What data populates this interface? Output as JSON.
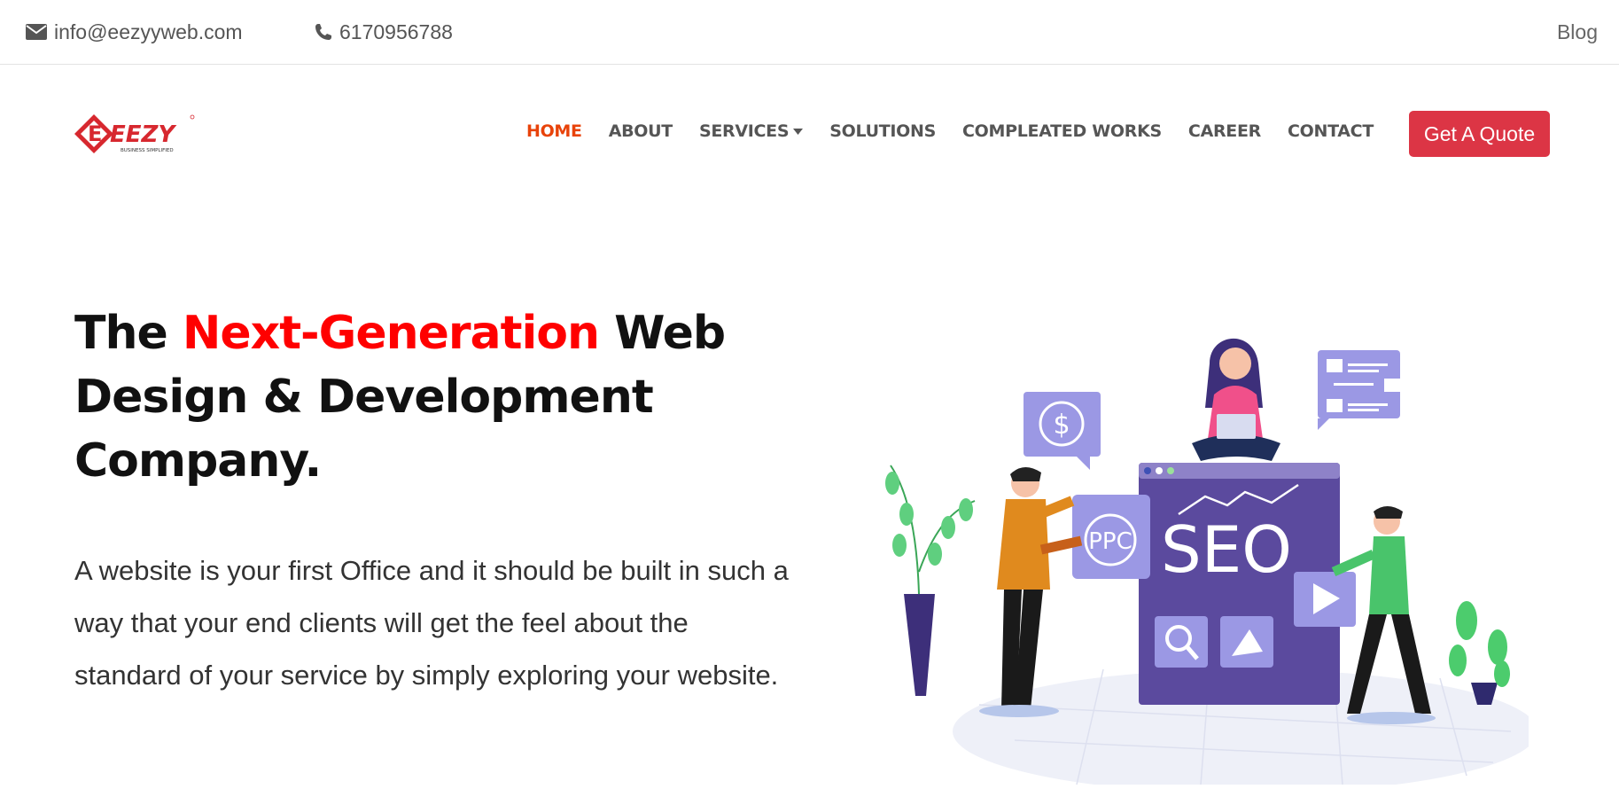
{
  "topbar": {
    "email": "info@eezyyweb.com",
    "phone": "6170956788",
    "blog": "Blog"
  },
  "brand": {
    "logo_text": "EEZY",
    "logo_tagline": "BUSINESS SIMPLIFIED"
  },
  "nav": {
    "items": [
      {
        "label": "HOME",
        "active": true
      },
      {
        "label": "ABOUT"
      },
      {
        "label": "SERVICES"
      },
      {
        "label": "SOLUTIONS"
      },
      {
        "label": "COMPLEATED WORKS"
      },
      {
        "label": "CAREER"
      },
      {
        "label": "CONTACT"
      }
    ],
    "cta": "Get A Quote"
  },
  "hero": {
    "title_pre": "The ",
    "title_accent": "Next-Generation",
    "title_post": " Web Design & Development Company.",
    "text": "A website is your first Office and it should be built in such a way that your end clients will get the feel about the standard of your service by simply exploring your website."
  },
  "illustration": {
    "label": "SEO",
    "badge": "PPC",
    "currency": "$"
  },
  "colors": {
    "accent": "#ff0000",
    "nav_active": "#e8430a",
    "cta": "#dc3545",
    "illustration_primary": "#5b4a9e",
    "illustration_light": "#9b98e4"
  }
}
